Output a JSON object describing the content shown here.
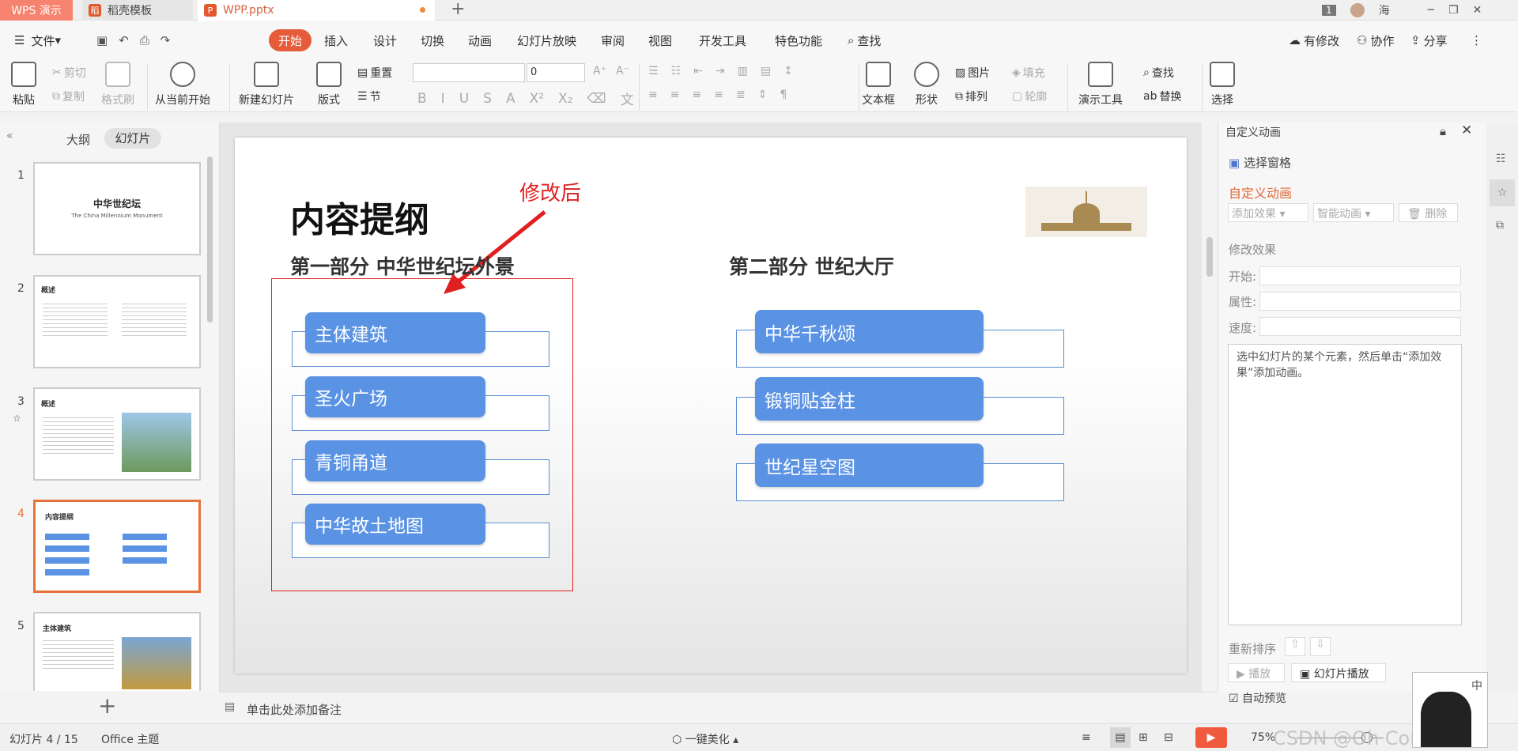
{
  "tabs": {
    "wps": "WPS 演示",
    "template": "稻壳模板",
    "file": "WPP.pptx"
  },
  "titlebar": {
    "badge": "1",
    "user": "海"
  },
  "menu": [
    "文件",
    "开始",
    "插入",
    "设计",
    "切换",
    "动画",
    "幻灯片放映",
    "审阅",
    "视图",
    "开发工具",
    "特色功能",
    "查找"
  ],
  "menu_right": [
    "有修改",
    "协作",
    "分享"
  ],
  "ribbon": {
    "paste": "粘贴",
    "cut": "剪切",
    "copy": "复制",
    "format": "格式刷",
    "start": "从当前开始",
    "new_slide": "新建幻灯片",
    "layout": "版式",
    "reset": "重置",
    "section": "节",
    "font_size": "0",
    "textbox": "文本框",
    "shape": "形状",
    "picture": "图片",
    "arrange": "排列",
    "fill": "填充",
    "outline": "轮廓",
    "present": "演示工具",
    "find": "查找",
    "replace": "替换",
    "select": "选择"
  },
  "left": {
    "outline": "大纲",
    "slides": "幻灯片"
  },
  "thumbs": [
    {
      "num": "1",
      "title": "中华世纪坛",
      "sub": "The China Millennium Monument"
    },
    {
      "num": "2",
      "title": "概述"
    },
    {
      "num": "3",
      "title": "概述"
    },
    {
      "num": "4",
      "title": "内容提纲"
    },
    {
      "num": "5",
      "title": "主体建筑"
    }
  ],
  "slide": {
    "title": "内容提纲",
    "annotation": "修改后",
    "part1": "第一部分 中华世纪坛外景",
    "part2": "第二部分 世纪大厅",
    "items1": [
      "主体建筑",
      "圣火广场",
      "青铜甬道",
      "中华故土地图"
    ],
    "items2": [
      "中华千秋颂",
      "锻铜贴金柱",
      "世纪星空图"
    ]
  },
  "panel": {
    "title": "自定义动画",
    "select_pane": "选择窗格",
    "custom": "自定义动画",
    "add_effect": "添加效果",
    "smart": "智能动画",
    "delete": "删除",
    "modify": "修改效果",
    "start": "开始:",
    "property": "属性:",
    "speed": "速度:",
    "hint": "选中幻灯片的某个元素，然后单击“添加效果”添加动画。",
    "reorder": "重新排序",
    "play": "播放",
    "slideshow": "幻灯片播放",
    "autopreview": "自动预览"
  },
  "notes": "单击此处添加备注",
  "status": {
    "slide": "幻灯片 4 / 15",
    "theme": "Office 主题",
    "beautify": "一键美化",
    "zoom": "75%",
    "watermark": "CSDN @Oh Correct"
  },
  "colors": {
    "accent": "#e65c3a",
    "pill": "#5b93e4",
    "red": "#e02020"
  }
}
